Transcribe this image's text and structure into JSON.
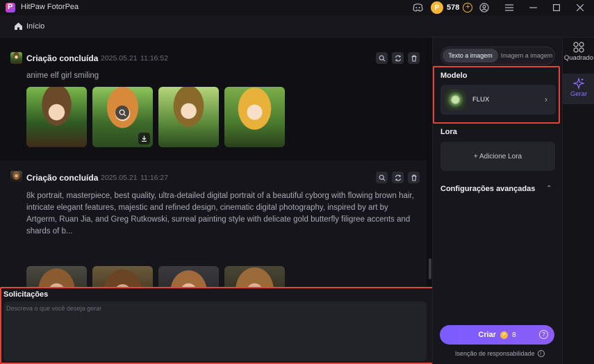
{
  "app": {
    "title": "HitPaw FotorPea",
    "coins": "578"
  },
  "breadcrumb": {
    "home_label": "Início"
  },
  "feed": {
    "cards": [
      {
        "title": "Criação concluída",
        "date": "2025.05.21",
        "time": "11:16:52",
        "prompt": "anime elf girl smiling"
      },
      {
        "title": "Criação concluída",
        "date": "2025.05.21",
        "time": "11:16:27",
        "prompt": "8k portrait, masterpiece, best quality, ultra-detailed digital portrait of a beautiful cyborg with flowing brown hair, intricate elegant features, majestic and refined design, cinematic digital photography, inspired by art by Artgerm, Ruan Jia, and Greg Rutkowski, surreal painting style with delicate gold butterfly filigree accents and shards of b..."
      }
    ]
  },
  "prompt_panel": {
    "label": "Solicitações",
    "placeholder": "Descreva o que você deseja gerar"
  },
  "side": {
    "tabs": [
      "Texto a imagem",
      "Imagem a imagem"
    ],
    "model_label": "Modelo",
    "model_name": "FLUX",
    "lora_label": "Lora",
    "add_lora": "+ Adicione Lora",
    "advanced_label": "Configurações avançadas",
    "create_label": "Criar",
    "create_cost": "8",
    "disclaimer": "Isenção de responsabilidade"
  },
  "rail": {
    "items": [
      {
        "label": "Quadrado"
      },
      {
        "label": "Gerar"
      }
    ]
  },
  "colors": {
    "accent": "#7b5cff",
    "highlight_border": "#e0453a",
    "coin": "#f5b638"
  }
}
